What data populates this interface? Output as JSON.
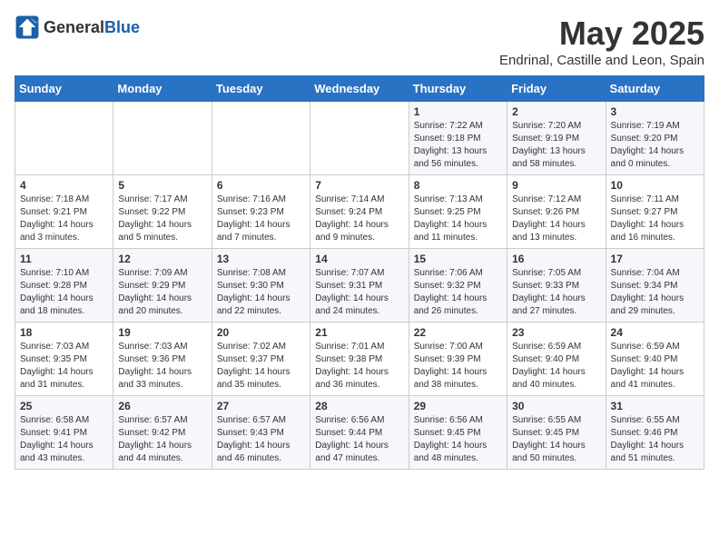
{
  "header": {
    "logo_general": "General",
    "logo_blue": "Blue",
    "title": "May 2025",
    "subtitle": "Endrinal, Castille and Leon, Spain"
  },
  "weekdays": [
    "Sunday",
    "Monday",
    "Tuesday",
    "Wednesday",
    "Thursday",
    "Friday",
    "Saturday"
  ],
  "weeks": [
    [
      {
        "day": "",
        "sunrise": "",
        "sunset": "",
        "daylight": ""
      },
      {
        "day": "",
        "sunrise": "",
        "sunset": "",
        "daylight": ""
      },
      {
        "day": "",
        "sunrise": "",
        "sunset": "",
        "daylight": ""
      },
      {
        "day": "",
        "sunrise": "",
        "sunset": "",
        "daylight": ""
      },
      {
        "day": "1",
        "sunrise": "Sunrise: 7:22 AM",
        "sunset": "Sunset: 9:18 PM",
        "daylight": "Daylight: 13 hours and 56 minutes."
      },
      {
        "day": "2",
        "sunrise": "Sunrise: 7:20 AM",
        "sunset": "Sunset: 9:19 PM",
        "daylight": "Daylight: 13 hours and 58 minutes."
      },
      {
        "day": "3",
        "sunrise": "Sunrise: 7:19 AM",
        "sunset": "Sunset: 9:20 PM",
        "daylight": "Daylight: 14 hours and 0 minutes."
      }
    ],
    [
      {
        "day": "4",
        "sunrise": "Sunrise: 7:18 AM",
        "sunset": "Sunset: 9:21 PM",
        "daylight": "Daylight: 14 hours and 3 minutes."
      },
      {
        "day": "5",
        "sunrise": "Sunrise: 7:17 AM",
        "sunset": "Sunset: 9:22 PM",
        "daylight": "Daylight: 14 hours and 5 minutes."
      },
      {
        "day": "6",
        "sunrise": "Sunrise: 7:16 AM",
        "sunset": "Sunset: 9:23 PM",
        "daylight": "Daylight: 14 hours and 7 minutes."
      },
      {
        "day": "7",
        "sunrise": "Sunrise: 7:14 AM",
        "sunset": "Sunset: 9:24 PM",
        "daylight": "Daylight: 14 hours and 9 minutes."
      },
      {
        "day": "8",
        "sunrise": "Sunrise: 7:13 AM",
        "sunset": "Sunset: 9:25 PM",
        "daylight": "Daylight: 14 hours and 11 minutes."
      },
      {
        "day": "9",
        "sunrise": "Sunrise: 7:12 AM",
        "sunset": "Sunset: 9:26 PM",
        "daylight": "Daylight: 14 hours and 13 minutes."
      },
      {
        "day": "10",
        "sunrise": "Sunrise: 7:11 AM",
        "sunset": "Sunset: 9:27 PM",
        "daylight": "Daylight: 14 hours and 16 minutes."
      }
    ],
    [
      {
        "day": "11",
        "sunrise": "Sunrise: 7:10 AM",
        "sunset": "Sunset: 9:28 PM",
        "daylight": "Daylight: 14 hours and 18 minutes."
      },
      {
        "day": "12",
        "sunrise": "Sunrise: 7:09 AM",
        "sunset": "Sunset: 9:29 PM",
        "daylight": "Daylight: 14 hours and 20 minutes."
      },
      {
        "day": "13",
        "sunrise": "Sunrise: 7:08 AM",
        "sunset": "Sunset: 9:30 PM",
        "daylight": "Daylight: 14 hours and 22 minutes."
      },
      {
        "day": "14",
        "sunrise": "Sunrise: 7:07 AM",
        "sunset": "Sunset: 9:31 PM",
        "daylight": "Daylight: 14 hours and 24 minutes."
      },
      {
        "day": "15",
        "sunrise": "Sunrise: 7:06 AM",
        "sunset": "Sunset: 9:32 PM",
        "daylight": "Daylight: 14 hours and 26 minutes."
      },
      {
        "day": "16",
        "sunrise": "Sunrise: 7:05 AM",
        "sunset": "Sunset: 9:33 PM",
        "daylight": "Daylight: 14 hours and 27 minutes."
      },
      {
        "day": "17",
        "sunrise": "Sunrise: 7:04 AM",
        "sunset": "Sunset: 9:34 PM",
        "daylight": "Daylight: 14 hours and 29 minutes."
      }
    ],
    [
      {
        "day": "18",
        "sunrise": "Sunrise: 7:03 AM",
        "sunset": "Sunset: 9:35 PM",
        "daylight": "Daylight: 14 hours and 31 minutes."
      },
      {
        "day": "19",
        "sunrise": "Sunrise: 7:03 AM",
        "sunset": "Sunset: 9:36 PM",
        "daylight": "Daylight: 14 hours and 33 minutes."
      },
      {
        "day": "20",
        "sunrise": "Sunrise: 7:02 AM",
        "sunset": "Sunset: 9:37 PM",
        "daylight": "Daylight: 14 hours and 35 minutes."
      },
      {
        "day": "21",
        "sunrise": "Sunrise: 7:01 AM",
        "sunset": "Sunset: 9:38 PM",
        "daylight": "Daylight: 14 hours and 36 minutes."
      },
      {
        "day": "22",
        "sunrise": "Sunrise: 7:00 AM",
        "sunset": "Sunset: 9:39 PM",
        "daylight": "Daylight: 14 hours and 38 minutes."
      },
      {
        "day": "23",
        "sunrise": "Sunrise: 6:59 AM",
        "sunset": "Sunset: 9:40 PM",
        "daylight": "Daylight: 14 hours and 40 minutes."
      },
      {
        "day": "24",
        "sunrise": "Sunrise: 6:59 AM",
        "sunset": "Sunset: 9:40 PM",
        "daylight": "Daylight: 14 hours and 41 minutes."
      }
    ],
    [
      {
        "day": "25",
        "sunrise": "Sunrise: 6:58 AM",
        "sunset": "Sunset: 9:41 PM",
        "daylight": "Daylight: 14 hours and 43 minutes."
      },
      {
        "day": "26",
        "sunrise": "Sunrise: 6:57 AM",
        "sunset": "Sunset: 9:42 PM",
        "daylight": "Daylight: 14 hours and 44 minutes."
      },
      {
        "day": "27",
        "sunrise": "Sunrise: 6:57 AM",
        "sunset": "Sunset: 9:43 PM",
        "daylight": "Daylight: 14 hours and 46 minutes."
      },
      {
        "day": "28",
        "sunrise": "Sunrise: 6:56 AM",
        "sunset": "Sunset: 9:44 PM",
        "daylight": "Daylight: 14 hours and 47 minutes."
      },
      {
        "day": "29",
        "sunrise": "Sunrise: 6:56 AM",
        "sunset": "Sunset: 9:45 PM",
        "daylight": "Daylight: 14 hours and 48 minutes."
      },
      {
        "day": "30",
        "sunrise": "Sunrise: 6:55 AM",
        "sunset": "Sunset: 9:45 PM",
        "daylight": "Daylight: 14 hours and 50 minutes."
      },
      {
        "day": "31",
        "sunrise": "Sunrise: 6:55 AM",
        "sunset": "Sunset: 9:46 PM",
        "daylight": "Daylight: 14 hours and 51 minutes."
      }
    ]
  ]
}
